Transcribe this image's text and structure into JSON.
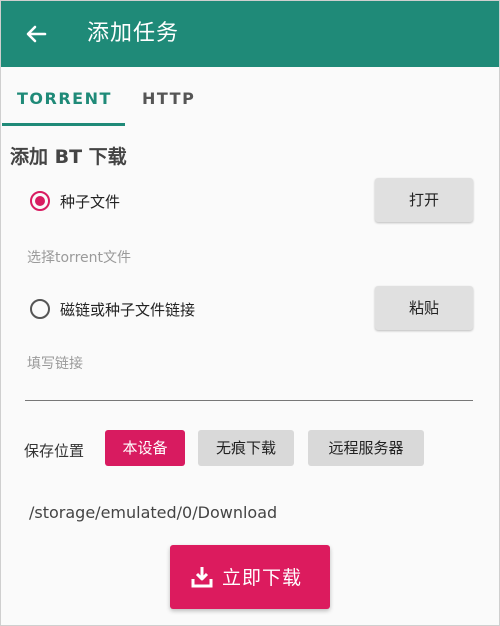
{
  "app_bar": {
    "title": "添加任务",
    "back_icon": "arrow-left-icon"
  },
  "tabs": [
    {
      "label": "TORRENT",
      "active": true
    },
    {
      "label": "HTTP",
      "active": false
    }
  ],
  "section_title": "添加 BT 下载",
  "torrent_file": {
    "label": "种子文件",
    "selected": true,
    "button": "打开",
    "hint": "选择torrent文件"
  },
  "magnet": {
    "label": "磁链或种子文件链接",
    "selected": false,
    "button": "粘贴",
    "placeholder": "填写链接",
    "value": ""
  },
  "save_location": {
    "label": "保存位置",
    "options": [
      "本设备",
      "无痕下载",
      "远程服务器"
    ],
    "selected": "本设备",
    "path": "/storage/emulated/0/Download"
  },
  "download_button": {
    "label": "立即下载",
    "icon": "download-icon"
  },
  "colors": {
    "primary": "#1f8a78",
    "accent": "#d81b60"
  }
}
